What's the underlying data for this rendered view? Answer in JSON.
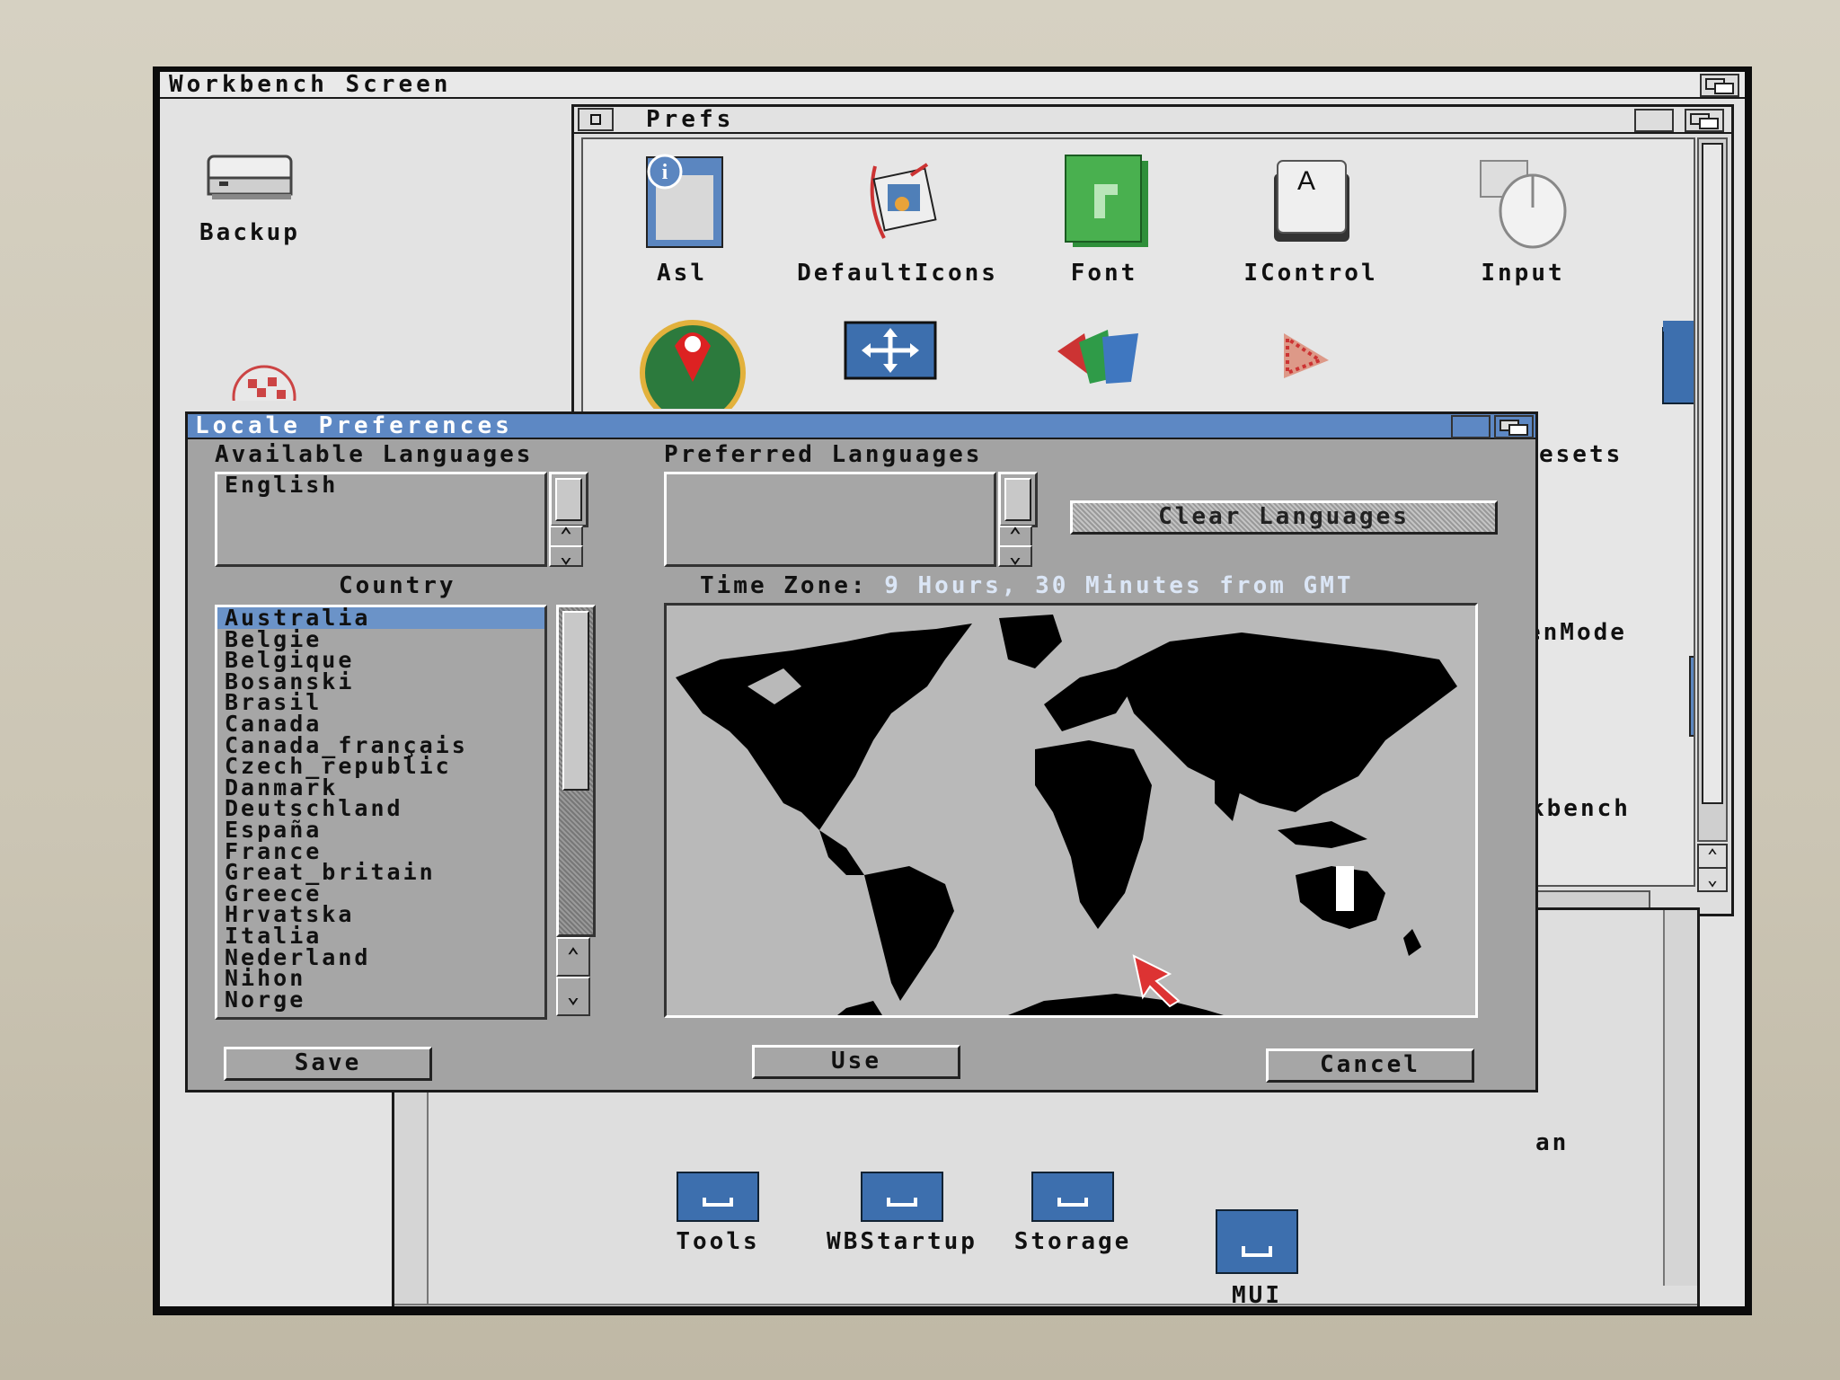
{
  "workbench": {
    "title": "Workbench Screen"
  },
  "desktop": {
    "backup_label": "Backup"
  },
  "prefs": {
    "title": "Prefs",
    "icons": [
      {
        "label": "Asl",
        "icon": "info-icon"
      },
      {
        "label": "DefaultIcons",
        "icon": "defaulticons-icon"
      },
      {
        "label": "Font",
        "icon": "font-icon"
      },
      {
        "label": "IControl",
        "icon": "keycap-icon"
      },
      {
        "label": "Input",
        "icon": "mouse-icon"
      }
    ],
    "partial_labels": [
      "esets",
      "enMode",
      "kbench",
      "an"
    ],
    "drawers": [
      {
        "label": "Tools"
      },
      {
        "label": "WBStartup"
      },
      {
        "label": "Storage"
      },
      {
        "label": "MUI"
      }
    ]
  },
  "locale": {
    "title": "Locale Preferences",
    "available_label": "Available Languages",
    "available_languages": [
      "English"
    ],
    "preferred_label": "Preferred Languages",
    "preferred_languages": [],
    "clear_button": "Clear Languages",
    "country_label": "Country",
    "countries": [
      "Australia",
      "Belgie",
      "Belgique",
      "Bosanski",
      "Brasil",
      "Canada",
      "Canada_français",
      "Czech_republic",
      "Danmark",
      "Deutschland",
      "España",
      "France",
      "Great_britain",
      "Greece",
      "Hrvatska",
      "Italia",
      "Nederland",
      "Nihon",
      "Norge"
    ],
    "selected_country": "Australia",
    "timezone_label": "Time Zone:",
    "timezone_value": "9 Hours, 30 Minutes from GMT",
    "save_button": "Save",
    "use_button": "Use",
    "cancel_button": "Cancel"
  },
  "colors": {
    "titlebar_active": "#5d88c4",
    "selection": "#6b93c8",
    "window_bg": "#a3a3a3",
    "land": "#000000",
    "sea": "#b9b9b9"
  }
}
